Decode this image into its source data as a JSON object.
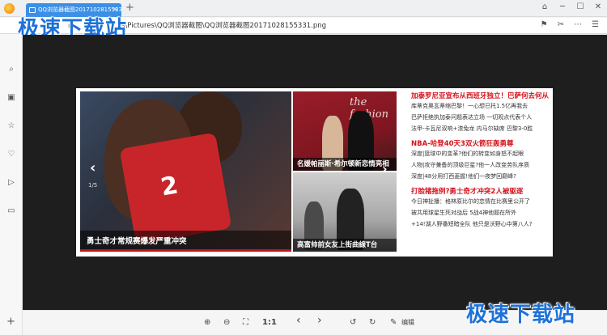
{
  "tab": {
    "title": "QQ浏览器截图20171028155331.png",
    "close": "×"
  },
  "new_tab": "+",
  "address": {
    "path": "C:\\Users\\Public\\Pictures\\QQ浏览器截图\\QQ浏览器截图20171028155331.png",
    "visible_path": "s\\Pictures\\QQ浏览器截图\\QQ浏览器截图20171028155331.png"
  },
  "watermark": "极速下载站",
  "window_controls": [
    "shirt-icon",
    "minimize-icon",
    "maximize-icon",
    "close-icon"
  ],
  "sidebar_icons": [
    "search-icon",
    "image-list-icon",
    "star-icon",
    "heart-icon",
    "play-icon",
    "video-icon"
  ],
  "image": {
    "main_caption": "勇士奇才常规赛爆发严重冲突",
    "slide_counter": "1/5",
    "jersey_number": "2",
    "top_caption": "名媛帕丽斯·希尔顿新恋情亮相",
    "top_logo": "the fashion",
    "bottom_caption": "高富帅前女友上街曲線T台"
  },
  "news": [
    {
      "headline": "加泰罗尼亚宣布从西班牙独立！巴萨何去何从",
      "lines": [
        "库蒂克奥瓦蒂缩巴黎！一心想已托1.5亿再我去",
        "巴萨拒绝执加泰问题表达立场 一切观点代表个人",
        "法甲-卡瓦尼双响+渣兔龙 内马尔缺席 巴黎3-0胜"
      ]
    },
    {
      "headline": "NBA-哈登40天3双火箭狂轰勇尊",
      "lines": [
        "深度|篮球中的变革?他们的转变如身怒不起眼",
        "人物|攻守兼备的顶级巨星?他一人改变劳队序质",
        "深度|48分用打西菱握!他们一夜梦回巅峰?"
      ]
    },
    {
      "headline": "打脸猪拖例?勇士奇才冲突2人被驱逐",
      "lines": [
        "今日神扯播：格林原比尔的恋情在比赛里公开了",
        "被共用球星生死对战后 5战4神他题在所外",
        "+14!湖人野番短暗全队 他只是沃野心中第八人?"
      ]
    }
  ],
  "toolbar": {
    "zoom_in": "zoom-in-icon",
    "zoom_out": "zoom-out-icon",
    "fit": "fit-screen-icon",
    "actual_size": "1:1",
    "prev": "‹",
    "next": "›",
    "rotate_left": "rotate-left-icon",
    "rotate_right": "rotate-right-icon",
    "edit": "编辑"
  },
  "add": "+"
}
